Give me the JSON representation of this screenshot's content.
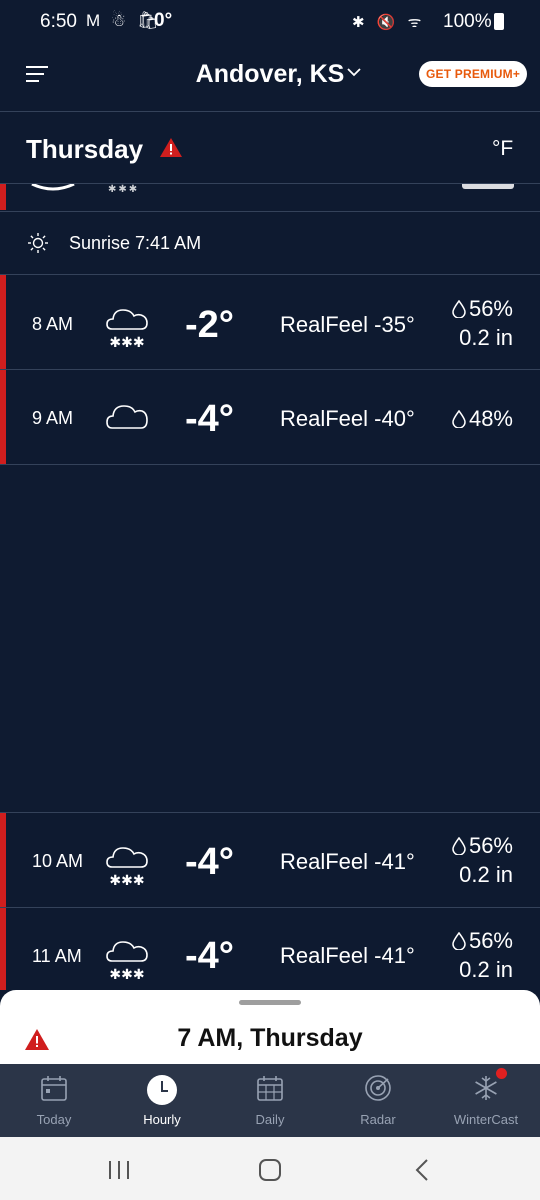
{
  "status_bar": {
    "time": "6:50",
    "left_icons": "M ☃ 🛍",
    "temperature": "0°",
    "right_icons": "✱ 🔇 ᯤ",
    "battery": "100%"
  },
  "header": {
    "location": "Andover, KS",
    "premium_label": "GET PREMIUM+"
  },
  "day_header": {
    "day": "Thursday",
    "unit": "°F"
  },
  "sunrise": {
    "label": "Sunrise 7:41 AM"
  },
  "hours": [
    {
      "time": "8 AM",
      "icon": "snow-cloud-icon",
      "temp": "-2°",
      "realfeel": "RealFeel -35°",
      "precip_pct": "56%",
      "precip_amt": "0.2 in"
    },
    {
      "time": "9 AM",
      "icon": "cloud-icon",
      "temp": "-4°",
      "realfeel": "RealFeel -40°",
      "precip_pct": "48%",
      "precip_amt": ""
    },
    {
      "time": "10 AM",
      "icon": "snow-cloud-icon",
      "temp": "-4°",
      "realfeel": "RealFeel -41°",
      "precip_pct": "56%",
      "precip_amt": "0.2 in"
    },
    {
      "time": "11 AM",
      "icon": "snow-cloud-icon",
      "temp": "-4°",
      "realfeel": "RealFeel -41°",
      "precip_pct": "56%",
      "precip_amt": "0.2 in"
    }
  ],
  "bottom_sheet": {
    "title": "7 AM, Thursday"
  },
  "nav": {
    "today": "Today",
    "hourly": "Hourly",
    "daily": "Daily",
    "radar": "Radar",
    "wintercast": "WinterCast",
    "active": "Hourly"
  },
  "colors": {
    "background": "#0e1a30",
    "alert_red": "#d01e1e",
    "premium_orange": "#e85a0c",
    "nav_background": "#2b3548"
  }
}
